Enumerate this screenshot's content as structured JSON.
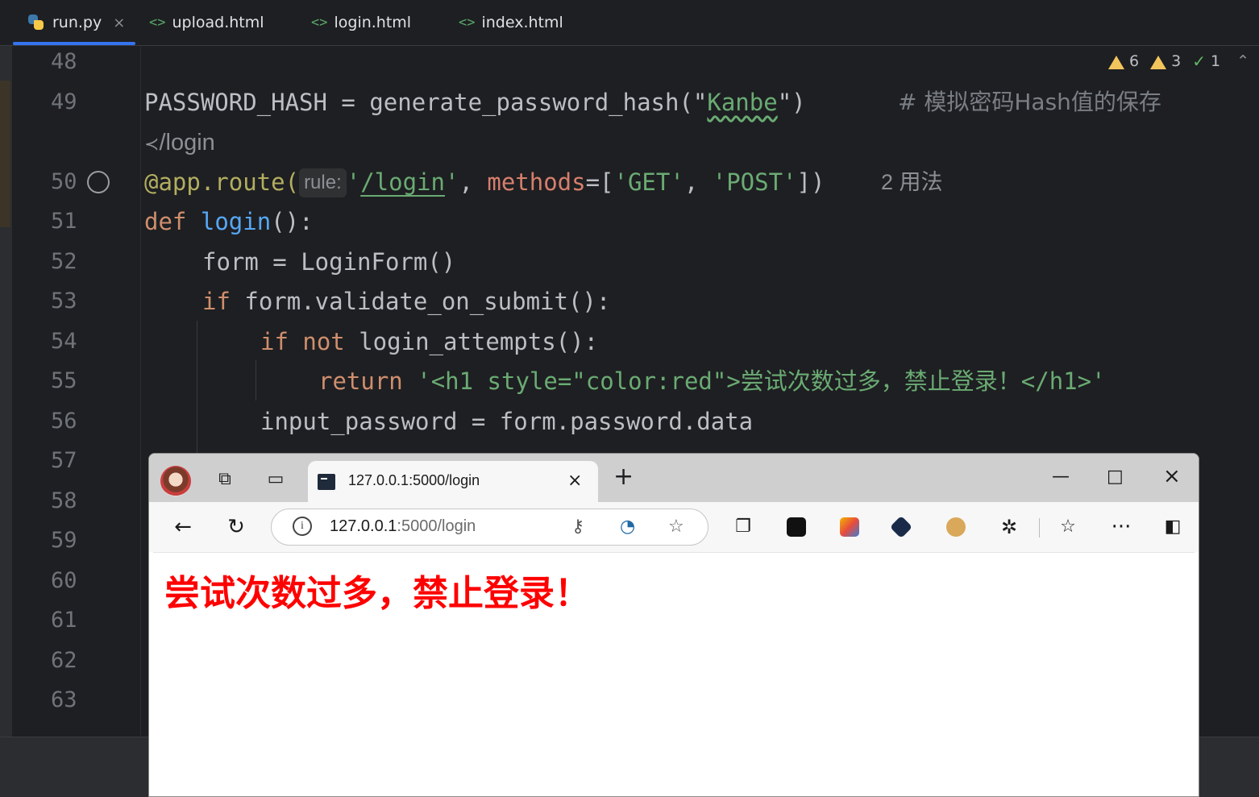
{
  "ide": {
    "tabs": [
      {
        "label": "run.py",
        "close": "×"
      },
      {
        "label": "upload.html"
      },
      {
        "label": "login.html"
      },
      {
        "label": "index.html"
      }
    ],
    "html_tab_icon": "<>",
    "inspections": {
      "warnings": "6",
      "weak_warnings": "3",
      "ok": "1"
    },
    "line_numbers": [
      "48",
      "49",
      "50",
      "51",
      "52",
      "53",
      "54",
      "55",
      "56",
      "57",
      "58",
      "59",
      "60",
      "61",
      "62",
      "63"
    ],
    "route_hint": "/login",
    "code": {
      "l49_a": "PASSWORD_HASH = generate_password_hash(\"",
      "l49_str": "Kanbe",
      "l49_b": "\")",
      "l49_comment": "# 模拟密码Hash值的保存",
      "l50_deco": "@app.route(",
      "l50_hint": "rule:",
      "l50_q1": "'",
      "l50_path": "/login",
      "l50_q2": "'",
      "l50_comma": ", ",
      "l50_named": "methods",
      "l50_eq": "=[",
      "l50_get": "'GET'",
      "l50_sep": ", ",
      "l50_post": "'POST'",
      "l50_end": "])",
      "l50_usage": "2 用法",
      "l51_def": "def",
      "l51_fn": "login",
      "l51_end": "():",
      "l52": "form = LoginForm()",
      "l53_kw": "if",
      "l53_rest": " form.validate_on_submit():",
      "l54_kw": "if not",
      "l54_rest": " login_attempts():",
      "l55_kw": "return",
      "l55_str": "'<h1 style=\"color:red\">尝试次数过多，禁止登录！</h1>'",
      "l56": "input_password = form.password.data"
    }
  },
  "browser": {
    "tab_title": "127.0.0.1:5000/login",
    "tab_close": "×",
    "new_tab": "+",
    "window": {
      "minimize": "—",
      "maximize": "□",
      "close": "×"
    },
    "url_host": "127.0.0.1",
    "url_rest": ":5000/login",
    "info": "i",
    "page_heading": "尝试次数过多，禁止登录！",
    "more": "···"
  },
  "colors": {
    "editor_bg": "#1e1f22",
    "keyword": "#cf8e6d",
    "function": "#56a8f5",
    "string": "#6aab73",
    "decorator": "#b3ae60",
    "heading_red": "#ff0000"
  }
}
